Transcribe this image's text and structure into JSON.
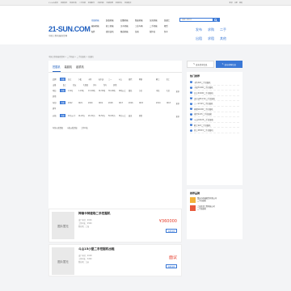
{
  "topbar": {
    "links": [
      "21-SUN首页",
      "机械资讯",
      "机械价格",
      "二手机械",
      "机械配件",
      "工程机械",
      "机械招聘",
      "机械论坛",
      "机械展会",
      "机械租赁",
      "机械视频"
    ],
    "right": [
      "登录",
      "注册",
      "我的"
    ]
  },
  "logo": {
    "mark": "21-SUN.COM",
    "sub": "中国工程机械商贸网"
  },
  "nav": [
    "挖掘机械",
    "装载机械",
    "起重机械",
    "路面机械",
    "压实机械",
    "混凝土",
    "破碎机械",
    "桩工机械",
    "叉车机械",
    "工业车辆",
    "二手机械",
    "租赁",
    "配件",
    "旋挖钻机",
    "隧道机械",
    "钻机",
    "搅拌站",
    "泵车"
  ],
  "search": {
    "placeholder": "请输入搜索词"
  },
  "rightlinks": [
    "发布",
    "求购",
    "二手",
    "出租",
    "求租",
    "其他"
  ],
  "breadcrumb": "中国工程机械商贸网 > 二手机械 > 二手挖掘机 > 挖掘机",
  "tabs": [
    "挖掘机",
    "装载机",
    "起重机"
  ],
  "filters": [
    {
      "label": "品牌",
      "options": [
        "不限",
        "日立",
        "小松",
        "卡特",
        "沃尔沃",
        "三一",
        "斗山",
        "现代",
        "神钢",
        "柳工",
        "徐工",
        "山推",
        "临工",
        "住友",
        "久保田",
        "洋马",
        "竹内",
        "其他"
      ]
    },
    {
      "label": "吨位",
      "options": [
        "不限",
        "1-6吨",
        "6-13吨",
        "13-20吨",
        "20-30吨",
        "30-40吨",
        "40吨以上",
        "微挖",
        "小挖",
        "中挖",
        "大挖",
        "其他"
      ]
    },
    {
      "label": "年份",
      "options": [
        "不限",
        "2022",
        "2021",
        "2020",
        "2019",
        "2018",
        "2017",
        "2016",
        "2015",
        "2014",
        "2013",
        "更早"
      ]
    },
    {
      "label": "价格",
      "options": [
        "不限",
        "10万以下",
        "10-20万",
        "20-30万",
        "30-50万",
        "50-80万",
        "80万以上",
        "面议",
        "其他"
      ]
    },
    {
      "label": "",
      "options": [
        "年份从新到旧",
        "价格从低到高",
        "工作时长"
      ]
    }
  ],
  "more_label": "更多",
  "cards": [
    {
      "title": "神钢卡特彼勒二手挖掘机",
      "meta": [
        "出厂年份：2016",
        "工作时长：4500",
        "所在地：上海"
      ],
      "price": "¥360000",
      "button": "查看详情",
      "photo": "图片暂无"
    },
    {
      "title": "斗山15小型二手挖掘机出租",
      "meta": [
        "出厂年份：2018",
        "工作时长：3200",
        "所在地：江苏"
      ],
      "price": "面议",
      "button": "查看详情",
      "photo": "图片暂无"
    }
  ],
  "side": {
    "btn1": "发布供求信息",
    "btn2": "发布求购信息",
    "hot_title": "热门推荐",
    "hot": [
      "卡特320二手挖掘机",
      "小松PC200二手挖掘机",
      "日立ZX200二手挖掘机",
      "沃尔沃EC210二手挖掘机",
      "三一SY215二手挖掘机",
      "神钢SK200二手挖掘机",
      "现代R215二手挖掘机",
      "斗山DX225二手挖掘机",
      "柳工922二手挖掘机",
      "徐工XE215二手挖掘机"
    ],
    "rec_title": "推荐品牌",
    "rec": [
      [
        "重庆市机械租赁有限公司",
        "二手挖掘机"
      ],
      [
        "上海某某工程机械公司",
        "二手装载机"
      ]
    ]
  }
}
